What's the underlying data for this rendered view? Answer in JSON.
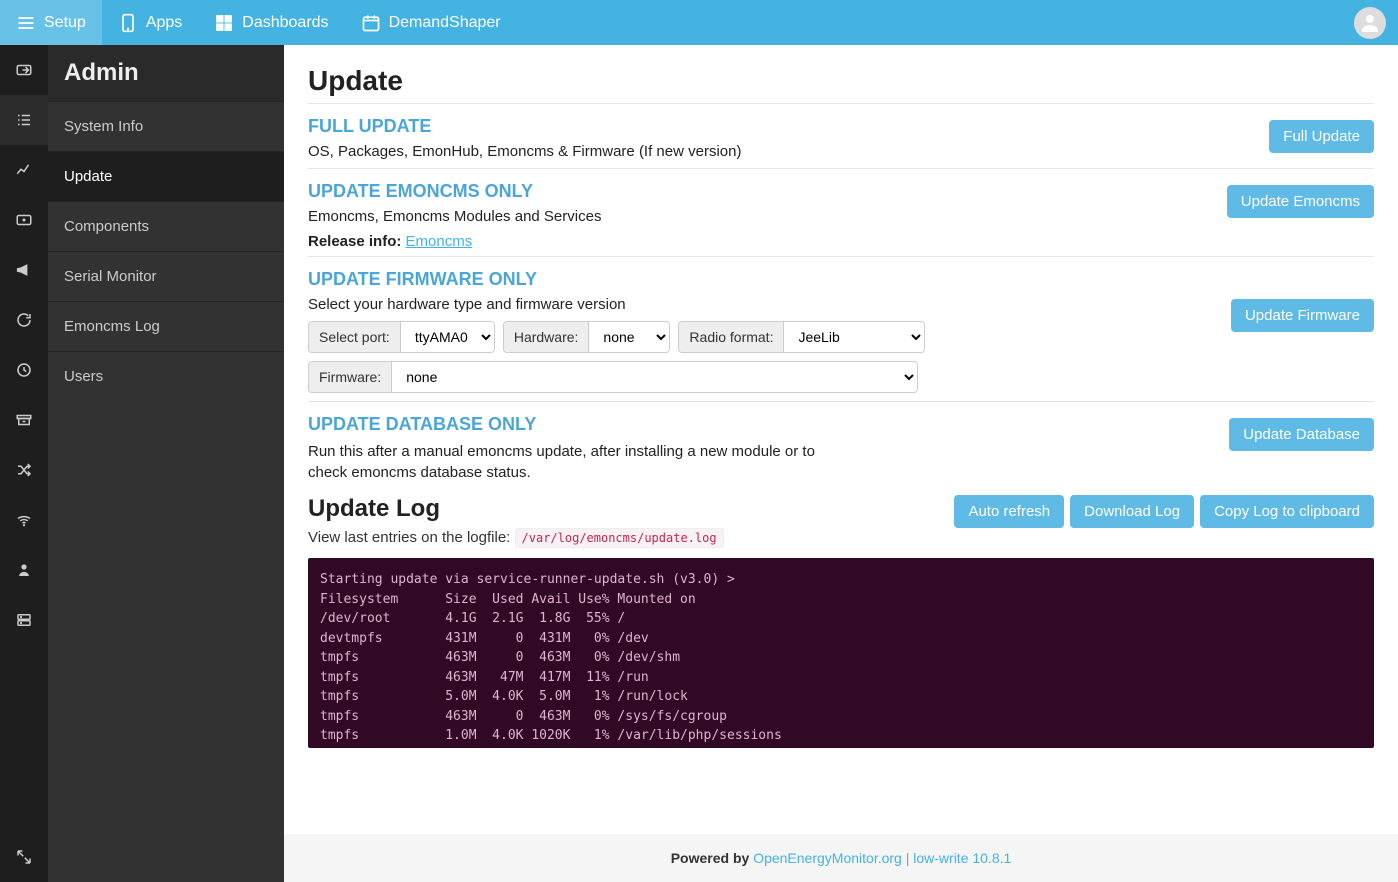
{
  "topbar": {
    "setup": "Setup",
    "apps": "Apps",
    "dashboards": "Dashboards",
    "demandshaper": "DemandShaper"
  },
  "sidebar": {
    "title": "Admin",
    "items": [
      {
        "label": "System Info"
      },
      {
        "label": "Update"
      },
      {
        "label": "Components"
      },
      {
        "label": "Serial Monitor"
      },
      {
        "label": "Emoncms Log"
      },
      {
        "label": "Users"
      }
    ]
  },
  "page": {
    "title": "Update",
    "sections": {
      "full": {
        "title": "FULL UPDATE",
        "desc": "OS, Packages, EmonHub, Emoncms & Firmware (If new version)",
        "button": "Full Update"
      },
      "emoncms": {
        "title": "UPDATE EMONCMS ONLY",
        "desc": "Emoncms, Emoncms Modules and Services",
        "release_label": "Release info:",
        "release_link": "Emoncms",
        "button": "Update Emoncms"
      },
      "firmware": {
        "title": "UPDATE FIRMWARE ONLY",
        "desc": "Select your hardware type and firmware version",
        "port_label": "Select port:",
        "port_value": "ttyAMA0",
        "hw_label": "Hardware:",
        "hw_value": "none",
        "radio_label": "Radio format:",
        "radio_value": "JeeLib",
        "fw_label": "Firmware:",
        "fw_value": "none",
        "button": "Update Firmware"
      },
      "database": {
        "title": "UPDATE DATABASE ONLY",
        "desc": "Run this after a manual emoncms update, after installing a new module or to check emoncms database status.",
        "button": "Update Database"
      }
    },
    "log": {
      "title": "Update Log",
      "desc": "View last entries on the logfile:",
      "path": "/var/log/emoncms/update.log",
      "btn_auto": "Auto refresh",
      "btn_download": "Download Log",
      "btn_copy": "Copy Log to clipboard",
      "content": "Starting update via service-runner-update.sh (v3.0) >\nFilesystem      Size  Used Avail Use% Mounted on\n/dev/root       4.1G  2.1G  1.8G  55% /\ndevtmpfs        431M     0  431M   0% /dev\ntmpfs           463M     0  463M   0% /dev/shm\ntmpfs           463M   47M  417M  11% /run\ntmpfs           5.0M  4.0K  5.0M   1% /run/lock\ntmpfs           463M     0  463M   0% /sys/fs/cgroup\ntmpfs           1.0M  4.0K 1020K   1% /var/lib/php/sessions"
    }
  },
  "footer": {
    "powered": "Powered by",
    "link": "OpenEnergyMonitor.org",
    "version": "low-write 10.8.1"
  }
}
